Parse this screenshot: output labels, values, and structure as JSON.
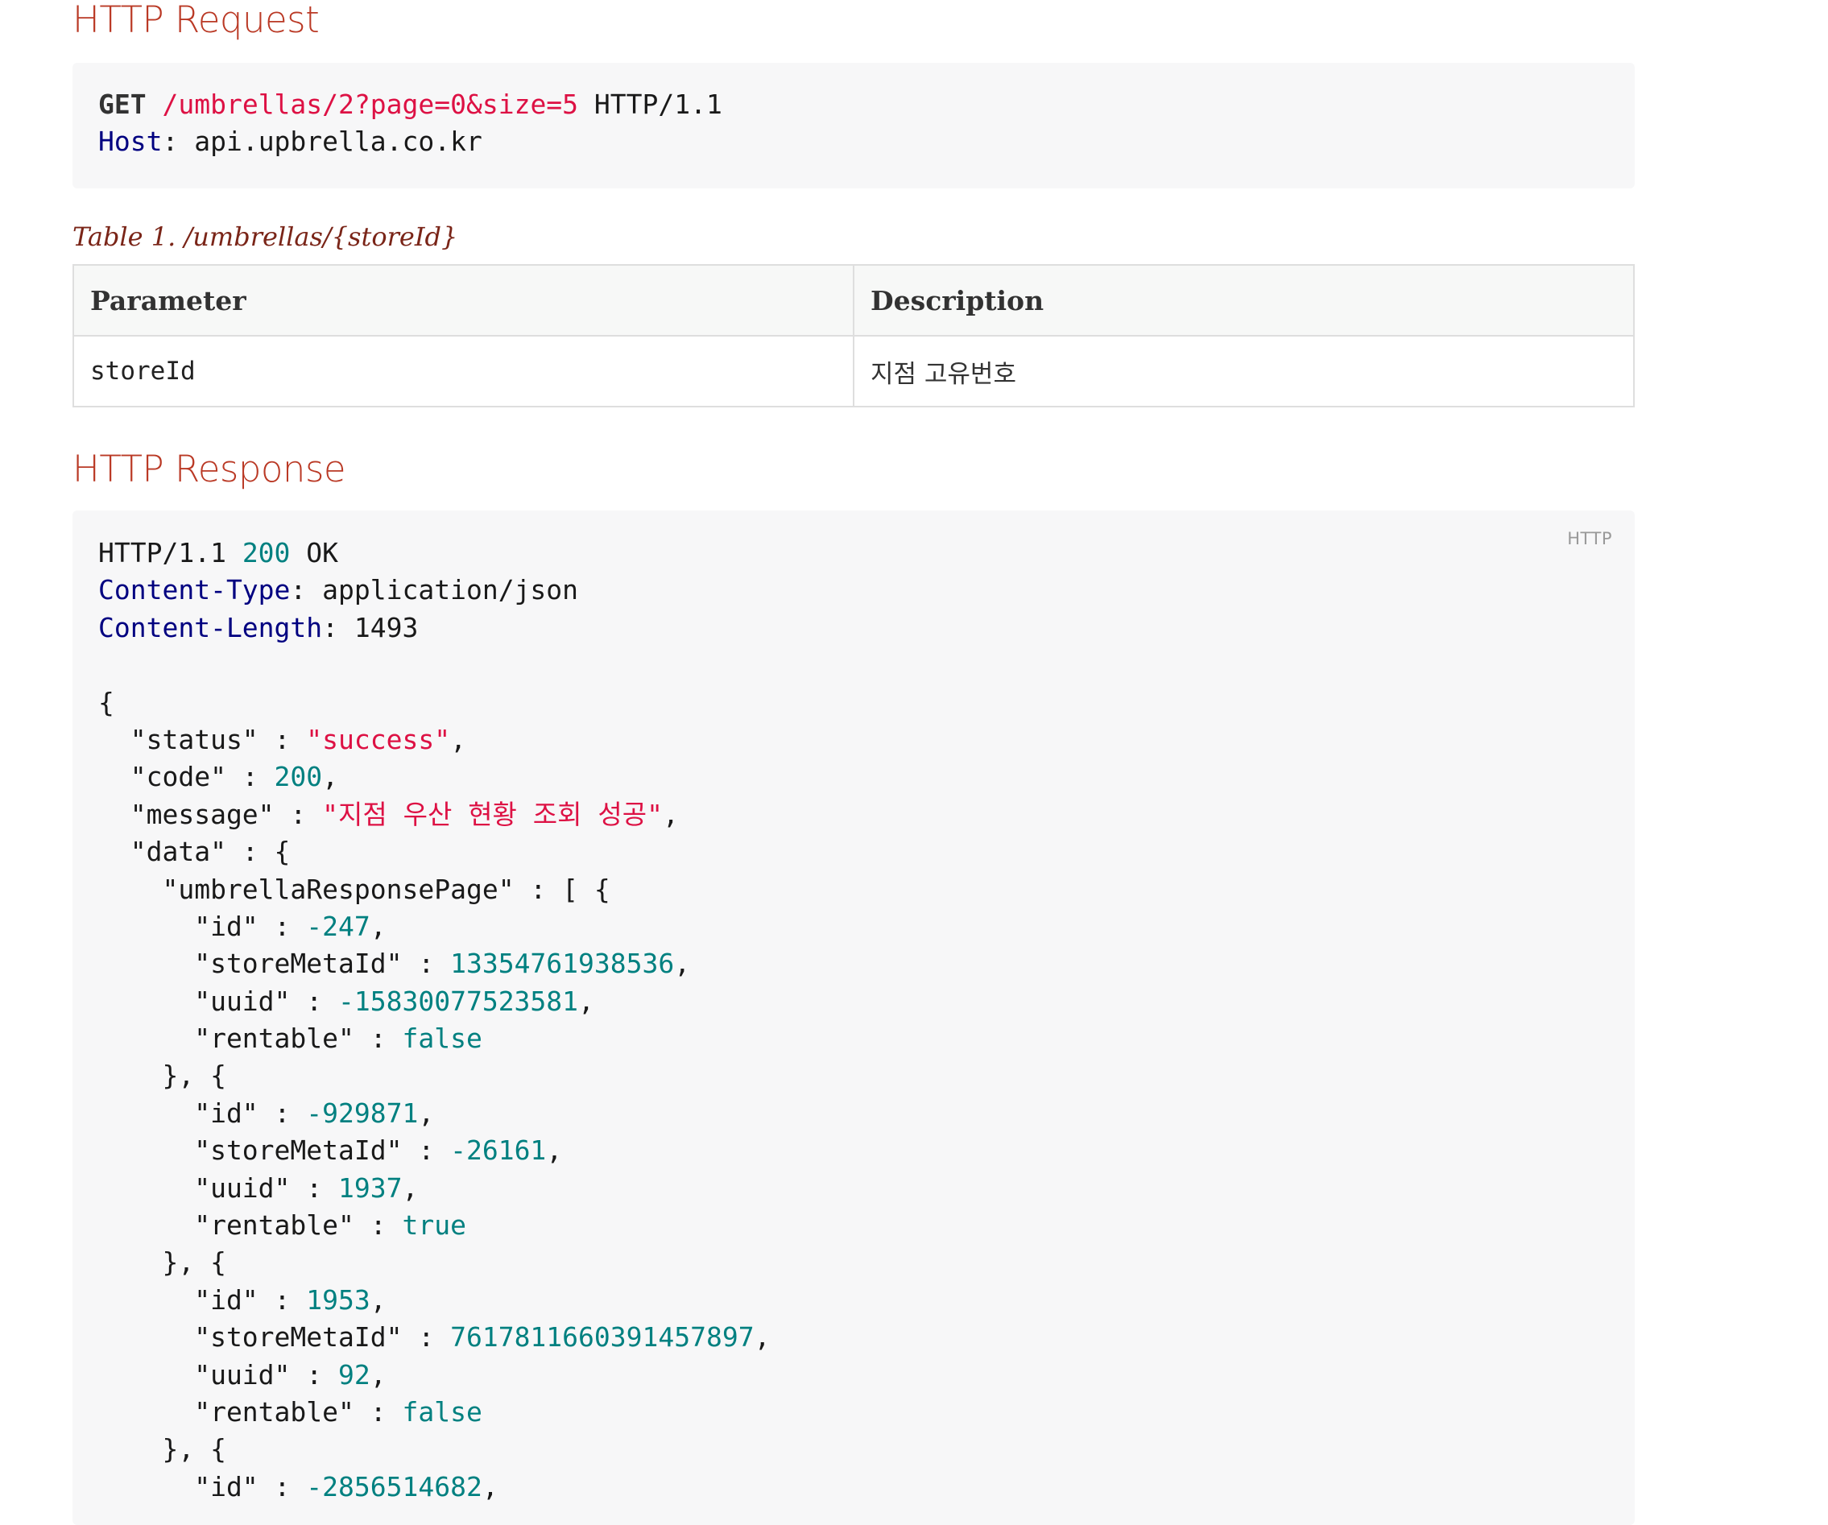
{
  "request": {
    "title": "HTTP Request",
    "method": "GET",
    "path": "/umbrellas/2?page=0&size=5",
    "protocol": " HTTP/1.1",
    "host_key": "Host",
    "host_value": ": api.upbrella.co.kr"
  },
  "table": {
    "caption": "Table 1. /umbrellas/{storeId}",
    "headers": [
      "Parameter",
      "Description"
    ],
    "rows": [
      {
        "param": "storeId",
        "desc": "지점 고유번호"
      }
    ]
  },
  "response": {
    "title": "HTTP Response",
    "lang_label": "HTTP",
    "status_line_prefix": "HTTP/1.1 ",
    "status_code": "200",
    "status_text": " OK",
    "headers": [
      {
        "key": "Content-Type",
        "value": ": application/json"
      },
      {
        "key": "Content-Length",
        "value": ": 1493"
      }
    ],
    "body": {
      "open": "{",
      "status_key": "  \"status\" : ",
      "status_val": "\"success\"",
      "code_key": "  \"code\" : ",
      "code_val": "200",
      "message_key": "  \"message\" : ",
      "message_val": "\"지점 우산 현황 조회 성공\"",
      "data_key": "  \"data\" : {",
      "page_key": "    \"umbrellaResponsePage\" : [ {",
      "sep": "    }, {",
      "items": [
        {
          "id": "-247",
          "storeMetaId": "13354761938536",
          "uuid": "-15830077523581",
          "rentable": "false"
        },
        {
          "id": "-929871",
          "storeMetaId": "-26161",
          "uuid": "1937",
          "rentable": "true"
        },
        {
          "id": "1953",
          "storeMetaId": "7617811660391457897",
          "uuid": "92",
          "rentable": "false"
        },
        {
          "id": "-2856514682"
        }
      ]
    }
  }
}
